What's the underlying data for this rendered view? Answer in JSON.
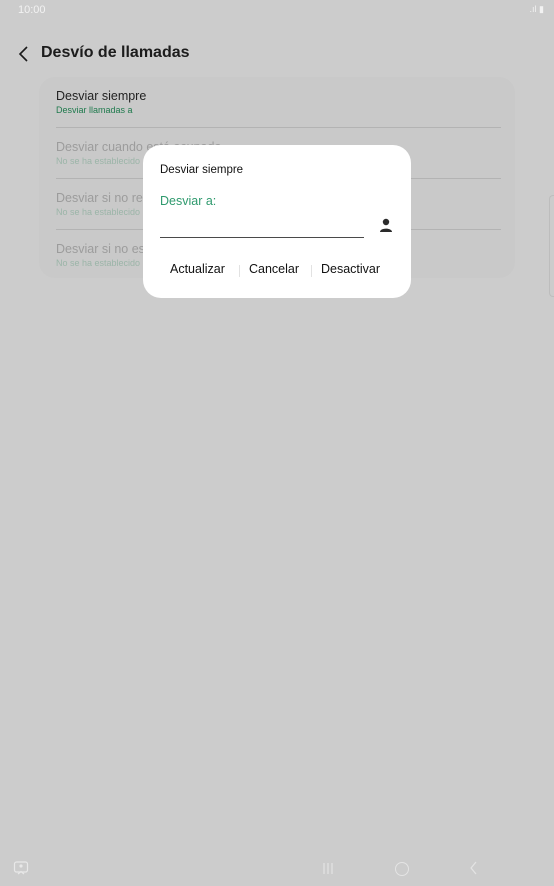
{
  "status": {
    "time": "10:00"
  },
  "header": {
    "title": "Desvío de llamadas"
  },
  "settings": {
    "rows": [
      {
        "label": "Desviar siempre",
        "sub": "Desviar llamadas a"
      },
      {
        "label": "Desviar cuando está ocupado",
        "sub": "No se ha establecido"
      },
      {
        "label": "Desviar si no responde",
        "sub": "No se ha establecido"
      },
      {
        "label": "Desviar si no está disponible",
        "sub": "No se ha establecido"
      }
    ]
  },
  "dialog": {
    "title": "Desviar siempre",
    "field_label": "Desviar a:",
    "field_value": "",
    "actions": {
      "update": "Actualizar",
      "cancel": "Cancelar",
      "disable": "Desactivar"
    }
  },
  "colors": {
    "accent": "#2f9a6e",
    "scrim": "#cccccc"
  },
  "icons": {
    "back": "chevron-left-icon",
    "contact": "person-icon",
    "keyboard": "keyboard-icon",
    "recents": "recents-icon",
    "home": "home-icon",
    "nav_back": "nav-back-icon"
  }
}
